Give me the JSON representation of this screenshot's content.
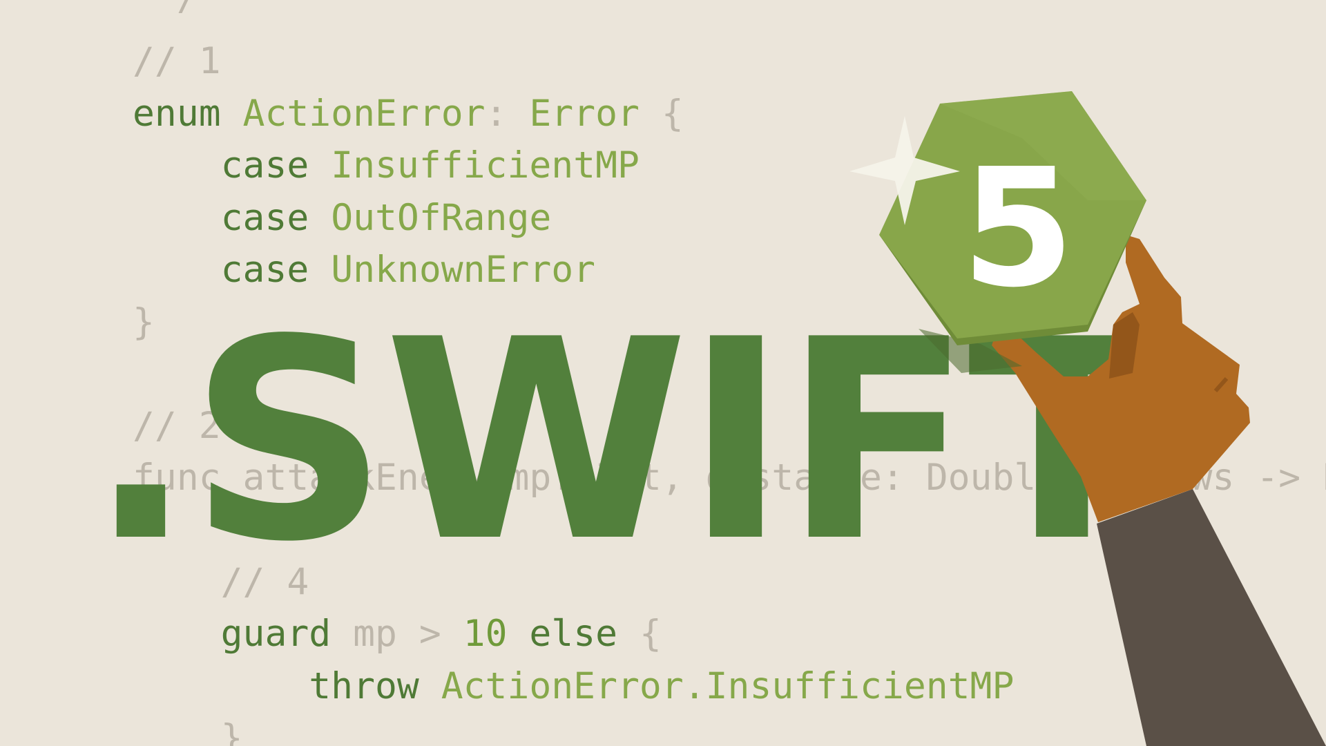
{
  "code_top": [
    {
      "tokens": [
        {
          "t": " */",
          "c": "dim"
        }
      ]
    },
    {
      "tokens": [
        {
          "t": "// 1",
          "c": "dim"
        }
      ]
    },
    {
      "tokens": [
        {
          "t": "enum ",
          "c": "kw"
        },
        {
          "t": "ActionError",
          "c": "type"
        },
        {
          "t": ": ",
          "c": "dim"
        },
        {
          "t": "Error",
          "c": "type"
        },
        {
          "t": " {",
          "c": "dim"
        }
      ]
    },
    {
      "tokens": [
        {
          "t": "    case ",
          "c": "kw"
        },
        {
          "t": "InsufficientMP",
          "c": "type"
        }
      ]
    },
    {
      "tokens": [
        {
          "t": "    case ",
          "c": "kw"
        },
        {
          "t": "OutOfRange",
          "c": "type"
        }
      ]
    },
    {
      "tokens": [
        {
          "t": "    case ",
          "c": "kw"
        },
        {
          "t": "UnknownError",
          "c": "type"
        }
      ]
    },
    {
      "tokens": [
        {
          "t": "}",
          "c": "dim"
        }
      ]
    }
  ],
  "code_mid": [
    {
      "tokens": [
        {
          "t": "// 2  3",
          "c": "dim"
        }
      ]
    },
    {
      "tokens": [
        {
          "t": "func attackEnemy(mp: Int, distance: Double) throws -> Bool {",
          "c": "dim"
        }
      ]
    }
  ],
  "code_bottom": [
    {
      "tokens": [
        {
          "t": "    // 4",
          "c": "dim"
        }
      ]
    },
    {
      "tokens": [
        {
          "t": "    guard ",
          "c": "kw"
        },
        {
          "t": "mp",
          "c": "dim"
        },
        {
          "t": " > ",
          "c": "dim"
        },
        {
          "t": "10",
          "c": "num"
        },
        {
          "t": " else",
          "c": "kw"
        },
        {
          "t": " {",
          "c": "dim"
        }
      ]
    },
    {
      "tokens": [
        {
          "t": "        throw ",
          "c": "kw"
        },
        {
          "t": "ActionError.InsufficientMP",
          "c": "type"
        }
      ]
    },
    {
      "tokens": [
        {
          "t": "    }",
          "c": "dim"
        }
      ]
    }
  ],
  "title": ".SWIFT",
  "badge": {
    "number": "5",
    "icons": [
      "sparkle-icon",
      "hexagon-badge"
    ]
  },
  "colors": {
    "background": "#ebe5da",
    "title": "#52803c",
    "keyword": "#4f7a36",
    "type": "#86a84a",
    "comment": "#bdb6aa",
    "badge_face": "#88a64a",
    "badge_side": "#6f8c38",
    "skin": "#b06a22",
    "sleeve": "#5a5047"
  }
}
